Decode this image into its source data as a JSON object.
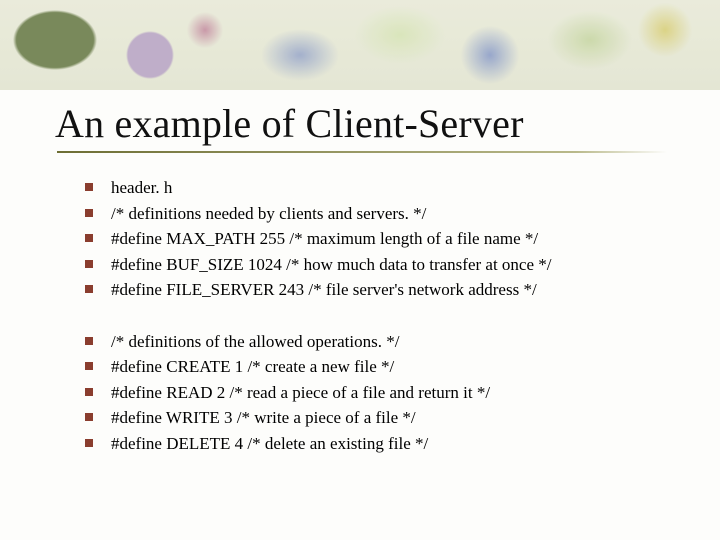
{
  "title": "An example of Client-Server",
  "group1": [
    "header. h",
    "/* definitions needed by clients and servers. */",
    "#define MAX_PATH 255 /* maximum length of a file name */",
    "#define BUF_SIZE 1024 /* how much data to transfer at once */",
    "#define FILE_SERVER 243 /* file server's network address */"
  ],
  "group2": [
    "/* definitions of the allowed operations. */",
    "#define CREATE 1 /* create a new file */",
    "#define READ 2    /* read a piece of a file and return it */",
    "#define WRITE 3   /* write a piece of a file */",
    "#define DELETE 4 /* delete an existing file */"
  ]
}
